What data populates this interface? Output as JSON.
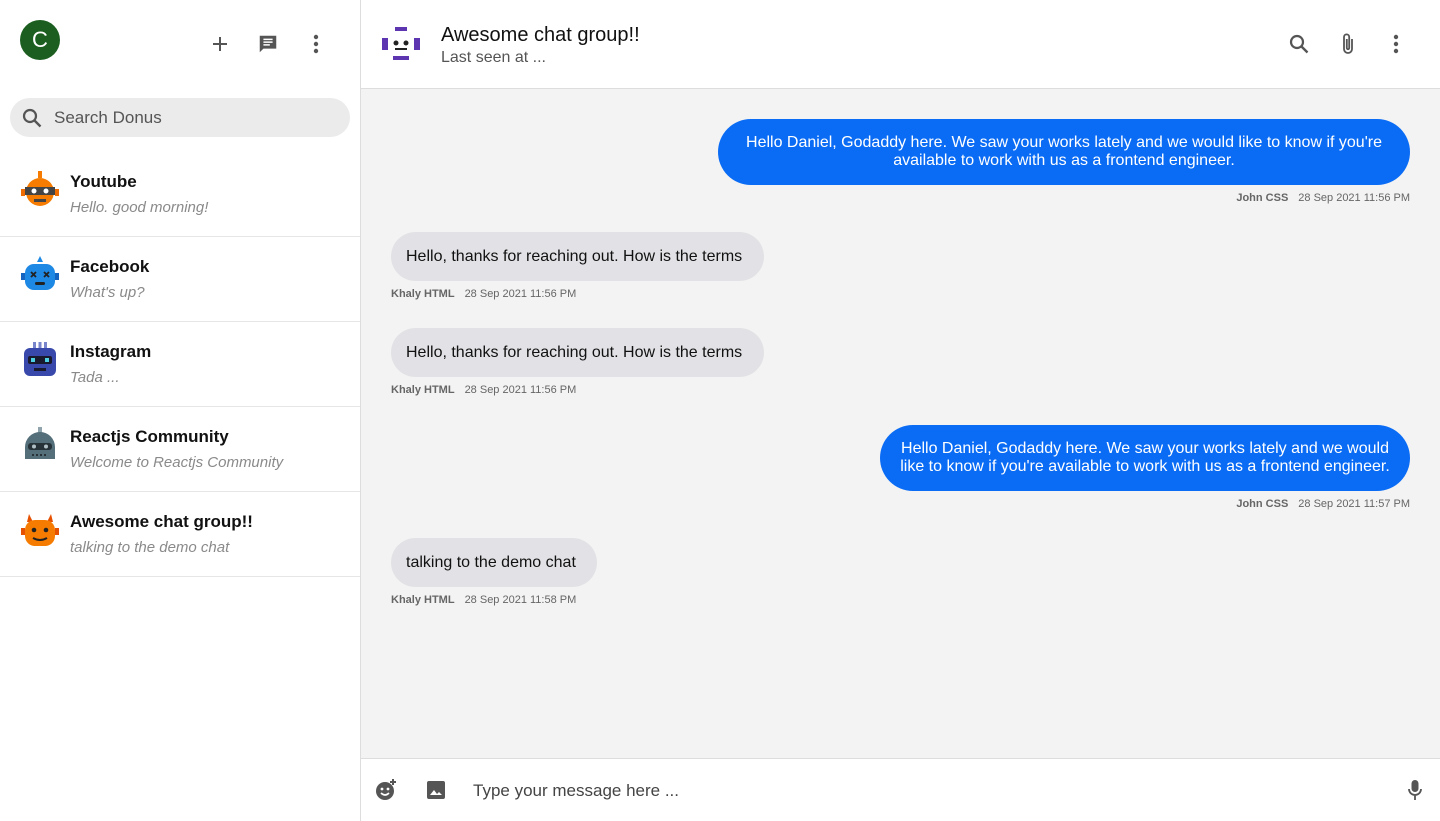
{
  "user": {
    "initial": "C"
  },
  "search": {
    "placeholder": "Search Donus"
  },
  "conversations": [
    {
      "name": "Youtube",
      "preview": "Hello. good morning!",
      "avatar_color": "#f57c00"
    },
    {
      "name": "Facebook",
      "preview": "What's up?",
      "avatar_color": "#1e88e5"
    },
    {
      "name": "Instagram",
      "preview": "Tada ...",
      "avatar_color": "#3949ab"
    },
    {
      "name": "Reactjs Community",
      "preview": "Welcome to Reactjs Community",
      "avatar_color": "#546e7a"
    },
    {
      "name": "Awesome chat group!!",
      "preview": "talking to the demo chat",
      "avatar_color": "#f57c00"
    }
  ],
  "chat": {
    "title": "Awesome chat group!!",
    "subtitle": "Last seen at ...",
    "avatar_color": "#5e35b1"
  },
  "messages": [
    {
      "text": "Hello Daniel, Godaddy here. We saw your works lately and we would like to know if you're available to work with us as a frontend engineer.",
      "author": "John CSS",
      "time": "28 Sep 2021 11:56 PM",
      "outgoing": true
    },
    {
      "text": "Hello, thanks for reaching out. How is the terms",
      "author": "Khaly HTML",
      "time": "28 Sep 2021 11:56 PM",
      "outgoing": false
    },
    {
      "text": "Hello, thanks for reaching out. How is the terms",
      "author": "Khaly HTML",
      "time": "28 Sep 2021 11:56 PM",
      "outgoing": false
    },
    {
      "text": "Hello Daniel, Godaddy here. We saw your works lately and we would like to know if you're available to work with us as a frontend engineer.",
      "author": "John CSS",
      "time": "28 Sep 2021 11:57 PM",
      "outgoing": true
    },
    {
      "text": "talking to the demo chat",
      "author": "Khaly HTML",
      "time": "28 Sep 2021 11:58 PM",
      "outgoing": false
    }
  ],
  "composer": {
    "placeholder": "Type your message here ..."
  },
  "colors": {
    "accent": "#0a6cf5",
    "incoming_bubble": "#e2e2e6"
  }
}
